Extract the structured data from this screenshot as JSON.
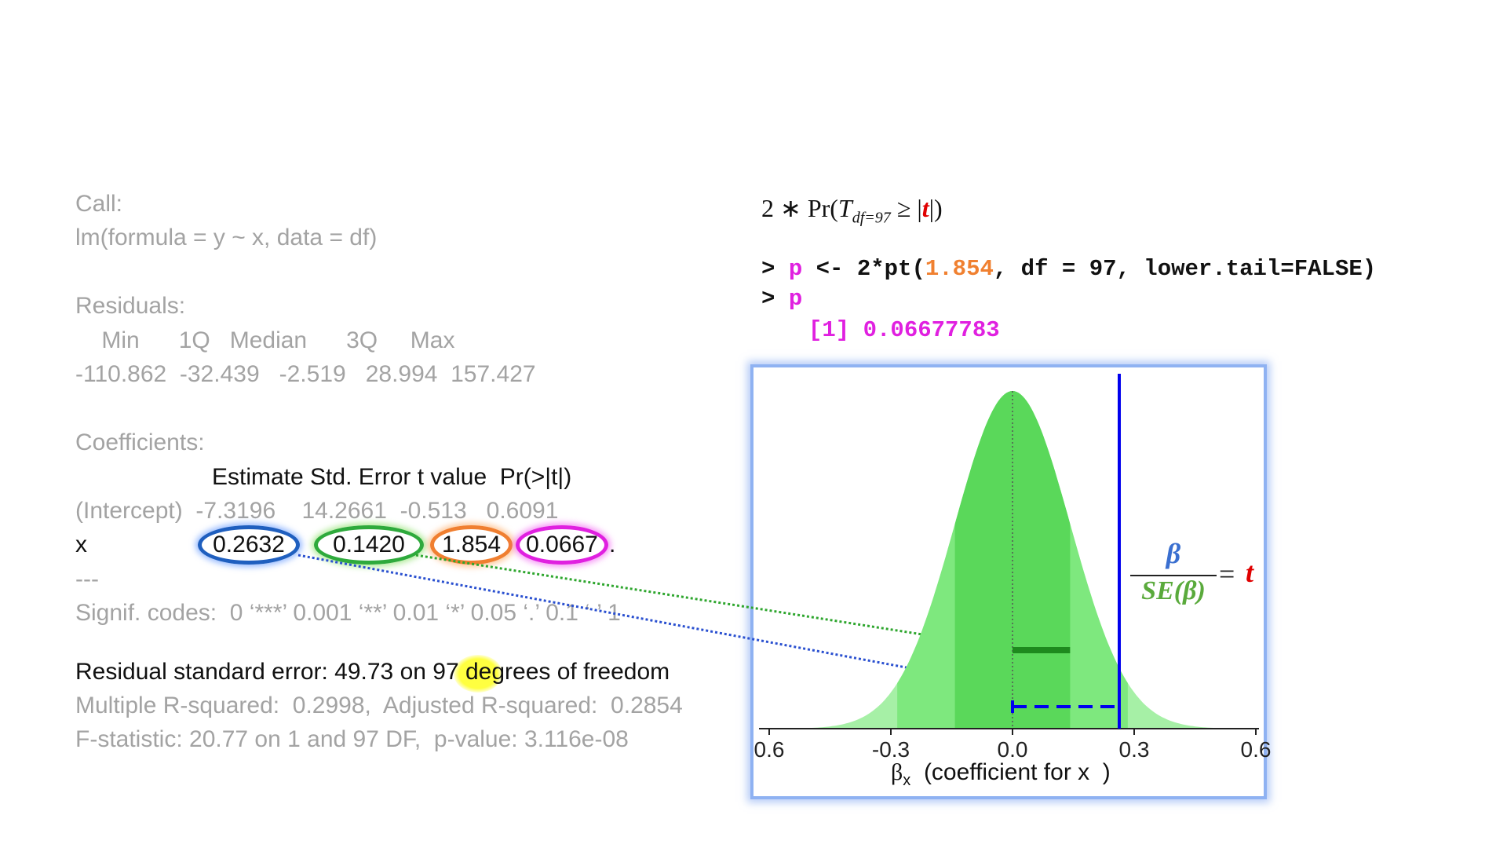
{
  "lm": {
    "call_label": "Call:",
    "call_text": "lm(formula = y ~ x, data = df)",
    "residuals_label": "Residuals:",
    "residuals_header": "    Min      1Q   Median      3Q     Max",
    "residuals_values": "-110.862  -32.439   -2.519   28.994  157.427",
    "coef_label": "Coefficients:",
    "coef_header": "Estimate Std. Error t value  Pr(>|t|)",
    "intercept_row": "(Intercept)  -7.3196    14.2661  -0.513   0.6091",
    "x_label": "x",
    "x_estimate": "0.2632",
    "x_se": "0.1420",
    "x_t": "1.854",
    "x_p": "0.0667",
    "x_signif": ".",
    "separator": "---",
    "signif_codes": "Signif. codes:  0 ‘***’ 0.001 ‘**’ 0.01 ‘*’ 0.05 ‘.’ 0.1 ‘ ’ 1",
    "rse_before": "Residual standard error: 49.73 on ",
    "rse_df": "97",
    "rse_after": " degrees of freedom",
    "r_squared": "Multiple R-squared:  0.2998,  Adjusted R-squared:  0.2854",
    "f_statistic": "F-statistic: 20.77 on 1 and 97 DF,  p-value: 3.116e-08"
  },
  "formula": {
    "prefix": "2 ∗ Pr(",
    "T": "T",
    "subscript": "df=97",
    "geq": " ≥ |",
    "t": "t",
    "suffix": "|)"
  },
  "r_code": {
    "prompt": ">",
    "line1_var": "p",
    "line1_mid": "<- 2*pt(",
    "line1_value": "1.854",
    "line1_rest": ", df = 97, lower.tail=FALSE)",
    "line2_var": "p",
    "output": "[1] 0.06677783"
  },
  "chart_data": {
    "type": "area",
    "title": "",
    "xlabel_symbol": "β",
    "xlabel_subscript": "x",
    "xlabel_text": "(coefficient for x  )",
    "x_ticks": [
      "0.6",
      "-0.3",
      "0.0",
      "0.3",
      "0.6"
    ],
    "xlim": [
      -0.6,
      0.6
    ],
    "distribution": "t-density centered at 0, df = 97, scaled by SE 0.1420",
    "center": 0.0,
    "standard_error": 0.142,
    "observed_beta": 0.2632,
    "band_outer": [
      -0.2842,
      0.2842
    ],
    "band_inner": [
      -0.142,
      0.142
    ],
    "se_segment": [
      0.0,
      0.142
    ],
    "beta_segment": [
      0.0,
      0.2632
    ]
  },
  "equation": {
    "numerator": "β",
    "denominator": "SE(β)",
    "equals": "=",
    "result": "t"
  },
  "colors": {
    "gray_text": "#a3a3a3",
    "estimate_oval": "#1f5fbf",
    "se_oval": "#2eaa3c",
    "t_oval": "#f07f30",
    "p_oval": "#e020e0",
    "df_highlight": "#ffff30",
    "beta_line": "#0000ee",
    "chart_fill_light": "#a6f0a6",
    "chart_fill_mid": "#7ee87e",
    "chart_fill_dark": "#5ad85a"
  }
}
